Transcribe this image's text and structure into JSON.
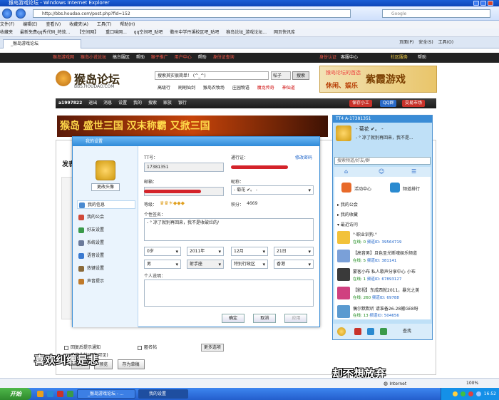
{
  "window": {
    "title": "猴岛游戏论坛 - Windows Internet Explorer"
  },
  "browser": {
    "url": "http://bbs.houdao.com/post.php?fid=152",
    "search_placeholder": "Google",
    "menu": [
      "文件(F)",
      "编辑(E)",
      "查看(V)",
      "收藏夹(A)",
      "工具(T)",
      "帮助(H)"
    ],
    "favorites": [
      "收藏夹",
      "最新免费qq秀代码_特效...",
      "【空间网】",
      "重口味网...",
      "qq空间吧_贴吧",
      "衢州中学丹溪校区吧_贴吧",
      "猴岛论坛_游戏论坛...",
      "网页快讯库"
    ],
    "tab": "_猴岛游戏论坛",
    "commands": [
      "页面(P)",
      "安全(S)",
      "工具(O)"
    ]
  },
  "site": {
    "topnav": [
      "猴岛游戏网",
      "猴岛小说论坛",
      "搞台服区",
      "帮助",
      "猴子推广",
      "用户中心",
      "帮助",
      "身份证查询"
    ],
    "topnav_right": [
      "身份认证",
      "客服中心",
      "社区服务",
      "帮助"
    ],
    "logo_text": "猴岛论坛",
    "logo_url": "BBS.HOUDAO.COM",
    "search_placeholder": "搜索其实很简单！ (^_^)",
    "search_scope": "帖子",
    "search_button": "搜索",
    "quick_links": [
      "高级行",
      "刷刷仙剑",
      "猴岛农牧场",
      "庄园物语",
      "魔龙传奇",
      "神仙道"
    ],
    "banner_top": "猴岛论坛的首选",
    "banner_main": "紫霞游戏",
    "banner_sub": "休闲、娱乐",
    "userbar": [
      "a1997822",
      "退出",
      "消息",
      "设置",
      "我的",
      "搜索",
      "家族",
      "银行"
    ],
    "userbar_right": [
      "保存小工",
      "QQ群",
      "交易市场"
    ],
    "promo_text": "猴岛 盛世三国  汉末称霸 又掀三国",
    "compose_title": "发表",
    "check_options": [
      "回复后提示通知",
      "匿名帖",
      "隐藏此帖(回复可见)"
    ],
    "more_options": "更多选项",
    "buttons": [
      "发表",
      "预览",
      "存为草稿"
    ],
    "watermark_left": "喜欢纠缠是悲",
    "watermark_right": "却不想放弃"
  },
  "dialog": {
    "title": "我的设置",
    "change_avatar": "更改头像",
    "nav": [
      "我的信息",
      "我的公会",
      "好友设置",
      "系统设置",
      "语音设置",
      "热键设置",
      "声音提示"
    ],
    "tt_label": "TT号：",
    "tt_value": "17381351",
    "pass_label": "通行证：",
    "change_pass": "修改密码",
    "email_label": "邮箱：",
    "nick_label": "昵称：",
    "nick_value": "- 菊花 ✔。  -",
    "level_label": "等级：",
    "points_label": "积分：",
    "points_value": "4669",
    "sig_label": "个性签名：",
    "sig_value": "- °  凉了就别再回来，我不是收破烂的/",
    "age": "0岁",
    "year": "2011年",
    "month": "12月",
    "day": "21日",
    "gender": "男",
    "zodiac": "射手座",
    "region": "特别行政区",
    "city": "香港",
    "intro_label": "个人说明：",
    "ok": "确定",
    "cancel": "取消",
    "apply": "应用"
  },
  "qq": {
    "title": "TT4  A-17381351",
    "nick": "- 菊花 ✔。  -",
    "signature": "- °  凉了就别再回来，我不是...",
    "search_placeholder": "搜索频道/好友/群",
    "activity": "活动中心",
    "ranking": "频道排行",
    "group1": "我的公会",
    "group2": "我的收藏",
    "group3": "最近访问",
    "recent": [
      {
        "name": "°·职业训狗.°",
        "online": "在线: 0",
        "channel": "频道ID: 39564719",
        "color": "#f2c23a"
      },
      {
        "name": "【高音男】且色圣光断魂娱乐频道",
        "online": "在线: 5",
        "channel": "频道ID: 381141",
        "color": "#7aa0d8"
      },
      {
        "name": "蒙客小布  私人歌声分享中心  小布",
        "online": "在线: 1",
        "channel": "频道ID: 67893127",
        "color": "#3a3a3a"
      },
      {
        "name": "【影视】东成西就2011，暴光之美",
        "online": "在线: 260",
        "channel": "频道ID: 69788",
        "color": "#d04080"
      },
      {
        "name": "偶尔默默听  请准备26-28搬GE8呀",
        "online": "在线: 13",
        "channel": "频道ID: 504656",
        "color": "#5a9ad0"
      }
    ],
    "find": "查找"
  },
  "statusbar": {
    "zone": "Internet",
    "zoom": "100%"
  },
  "taskbar": {
    "start": "开始",
    "tasks": [
      "_猴岛游戏论坛 - ...",
      "我的设置"
    ],
    "clock": "16:52"
  }
}
